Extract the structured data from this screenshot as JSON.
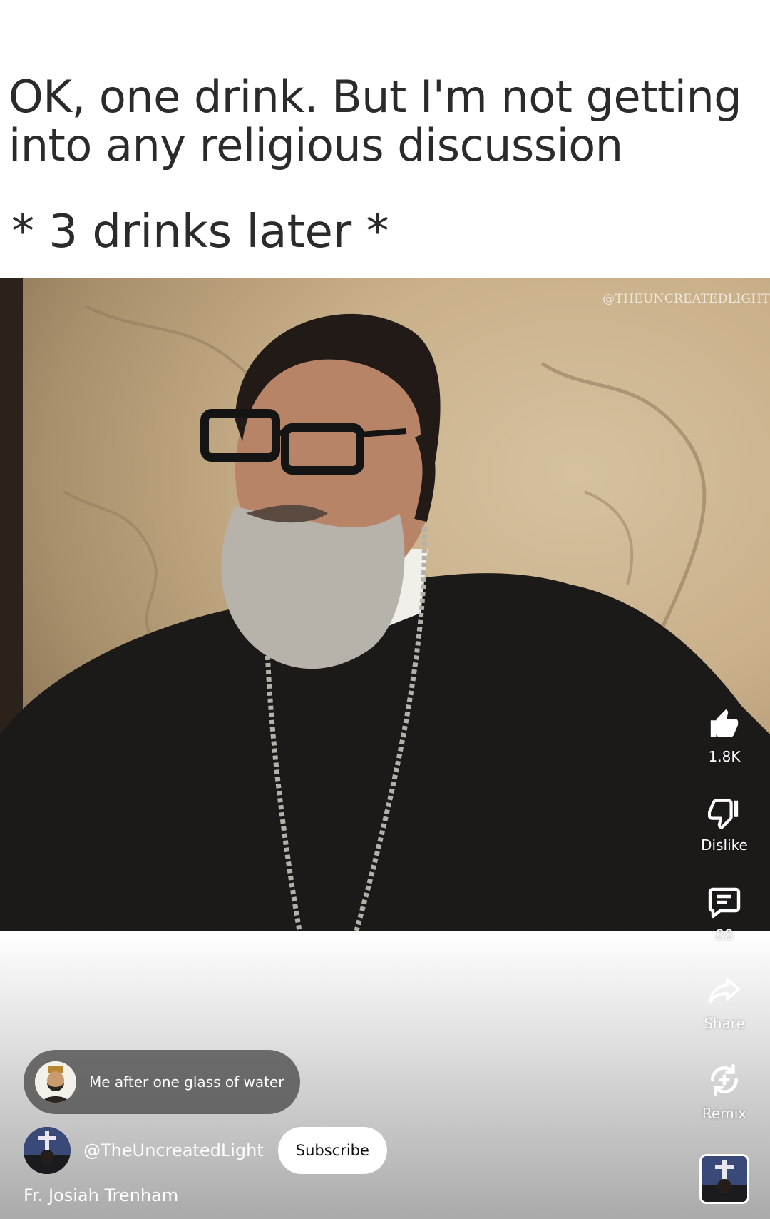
{
  "meme": {
    "caption_line1": "OK, one drink. But I'm not getting into any religious discussion",
    "caption_line2": "* 3 drinks later *",
    "watermark": "@THEUNCREATEDLIGHT"
  },
  "actions": {
    "like_count": "1.8K",
    "dislike_label": "Dislike",
    "comment_count": "88",
    "share_label": "Share",
    "remix_label": "Remix"
  },
  "comment_preview": {
    "text": "Me after one glass of water"
  },
  "channel": {
    "handle": "@TheUncreatedLight",
    "subscribe_label": "Subscribe"
  },
  "video": {
    "title": "Fr. Josiah Trenham"
  },
  "colors": {
    "overlay_text": "#ffffff",
    "caption_text": "#2b2b2b",
    "bubble_bg": "#505050"
  },
  "icons": [
    "like-icon",
    "dislike-icon",
    "comment-icon",
    "share-icon",
    "remix-icon"
  ]
}
